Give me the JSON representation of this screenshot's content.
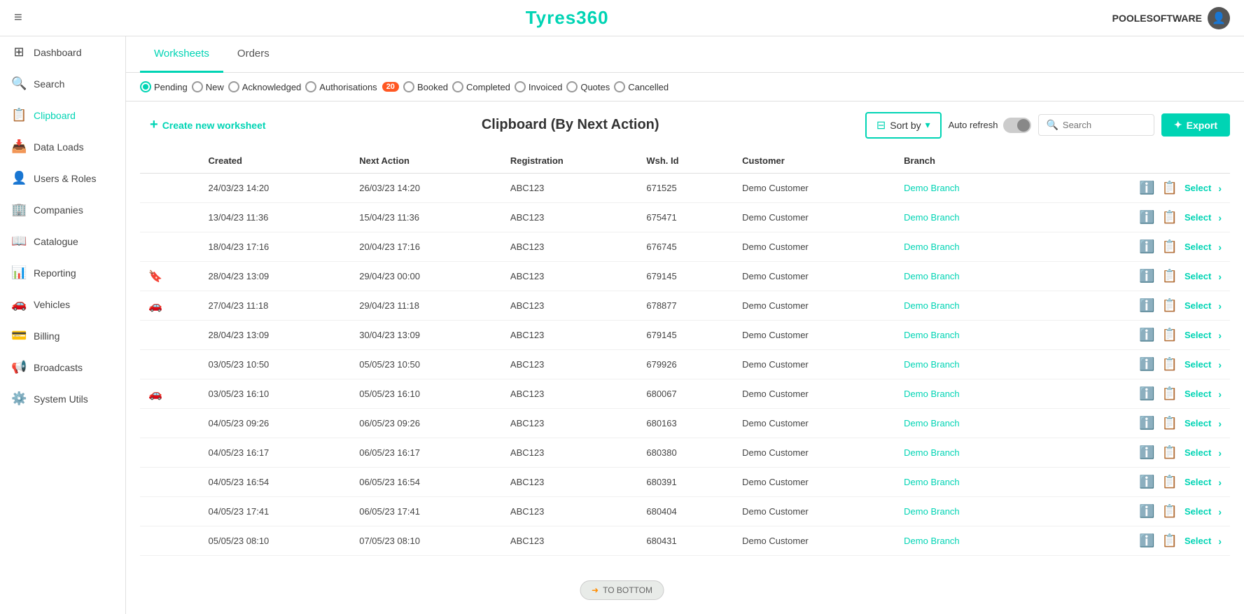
{
  "app": {
    "title": "Tyres360",
    "user": "POOLESOFTWARE"
  },
  "topbar": {
    "hamburger": "≡"
  },
  "sidebar": {
    "items": [
      {
        "id": "dashboard",
        "label": "Dashboard",
        "icon": "⊞",
        "active": false
      },
      {
        "id": "search",
        "label": "Search",
        "icon": "🔍",
        "active": false
      },
      {
        "id": "clipboard",
        "label": "Clipboard",
        "icon": "📋",
        "active": true
      },
      {
        "id": "data-loads",
        "label": "Data Loads",
        "icon": "📥",
        "active": false
      },
      {
        "id": "users-roles",
        "label": "Users & Roles",
        "icon": "👤",
        "active": false
      },
      {
        "id": "companies",
        "label": "Companies",
        "icon": "🏢",
        "active": false
      },
      {
        "id": "catalogue",
        "label": "Catalogue",
        "icon": "📖",
        "active": false
      },
      {
        "id": "reporting",
        "label": "Reporting",
        "icon": "📊",
        "active": false
      },
      {
        "id": "vehicles",
        "label": "Vehicles",
        "icon": "🚗",
        "active": false
      },
      {
        "id": "billing",
        "label": "Billing",
        "icon": "💳",
        "active": false
      },
      {
        "id": "broadcasts",
        "label": "Broadcasts",
        "icon": "📢",
        "active": false
      },
      {
        "id": "system-utils",
        "label": "System Utils",
        "icon": "⚙️",
        "active": false
      }
    ]
  },
  "tabs": [
    {
      "id": "worksheets",
      "label": "Worksheets",
      "active": true
    },
    {
      "id": "orders",
      "label": "Orders",
      "active": false
    }
  ],
  "filters": [
    {
      "id": "pending",
      "label": "Pending",
      "checked": true,
      "badge": null
    },
    {
      "id": "new",
      "label": "New",
      "checked": false,
      "badge": null
    },
    {
      "id": "acknowledged",
      "label": "Acknowledged",
      "checked": false,
      "badge": null
    },
    {
      "id": "authorisations",
      "label": "Authorisations",
      "checked": false,
      "badge": "20"
    },
    {
      "id": "booked",
      "label": "Booked",
      "checked": false,
      "badge": null
    },
    {
      "id": "completed",
      "label": "Completed",
      "checked": false,
      "badge": null
    },
    {
      "id": "invoiced",
      "label": "Invoiced",
      "checked": false,
      "badge": null
    },
    {
      "id": "quotes",
      "label": "Quotes",
      "checked": false,
      "badge": null
    },
    {
      "id": "cancelled",
      "label": "Cancelled",
      "checked": false,
      "badge": null
    }
  ],
  "toolbar": {
    "create_label": "Create new worksheet",
    "title": "Clipboard (By Next Action)",
    "sort_label": "Sort by",
    "auto_refresh_label": "Auto refresh",
    "search_placeholder": "Search",
    "export_label": "Export"
  },
  "table": {
    "columns": [
      "",
      "Created",
      "Next Action",
      "Registration",
      "Wsh. Id",
      "Customer",
      "Branch",
      ""
    ],
    "rows": [
      {
        "icon": "",
        "created": "24/03/23 14:20",
        "next_action": "26/03/23 14:20",
        "registration": "ABC123",
        "wsh_id": "671525",
        "customer": "Demo Customer",
        "branch": "Demo Branch"
      },
      {
        "icon": "",
        "created": "13/04/23 11:36",
        "next_action": "15/04/23 11:36",
        "registration": "ABC123",
        "wsh_id": "675471",
        "customer": "Demo Customer",
        "branch": "Demo Branch"
      },
      {
        "icon": "",
        "created": "18/04/23 17:16",
        "next_action": "20/04/23 17:16",
        "registration": "ABC123",
        "wsh_id": "676745",
        "customer": "Demo Customer",
        "branch": "Demo Branch"
      },
      {
        "icon": "bookmark",
        "created": "28/04/23 13:09",
        "next_action": "29/04/23 00:00",
        "registration": "ABC123",
        "wsh_id": "679145",
        "customer": "Demo Customer",
        "branch": "Demo Branch"
      },
      {
        "icon": "vehicle",
        "created": "27/04/23 11:18",
        "next_action": "29/04/23 11:18",
        "registration": "ABC123",
        "wsh_id": "678877",
        "customer": "Demo Customer",
        "branch": "Demo Branch"
      },
      {
        "icon": "",
        "created": "28/04/23 13:09",
        "next_action": "30/04/23 13:09",
        "registration": "ABC123",
        "wsh_id": "679145",
        "customer": "Demo Customer",
        "branch": "Demo Branch"
      },
      {
        "icon": "",
        "created": "03/05/23 10:50",
        "next_action": "05/05/23 10:50",
        "registration": "ABC123",
        "wsh_id": "679926",
        "customer": "Demo Customer",
        "branch": "Demo Branch"
      },
      {
        "icon": "vehicle",
        "created": "03/05/23 16:10",
        "next_action": "05/05/23 16:10",
        "registration": "ABC123",
        "wsh_id": "680067",
        "customer": "Demo Customer",
        "branch": "Demo Branch"
      },
      {
        "icon": "",
        "created": "04/05/23 09:26",
        "next_action": "06/05/23 09:26",
        "registration": "ABC123",
        "wsh_id": "680163",
        "customer": "Demo Customer",
        "branch": "Demo Branch"
      },
      {
        "icon": "",
        "created": "04/05/23 16:17",
        "next_action": "06/05/23 16:17",
        "registration": "ABC123",
        "wsh_id": "680380",
        "customer": "Demo Customer",
        "branch": "Demo Branch"
      },
      {
        "icon": "",
        "created": "04/05/23 16:54",
        "next_action": "06/05/23 16:54",
        "registration": "ABC123",
        "wsh_id": "680391",
        "customer": "Demo Customer",
        "branch": "Demo Branch"
      },
      {
        "icon": "",
        "created": "04/05/23 17:41",
        "next_action": "06/05/23 17:41",
        "registration": "ABC123",
        "wsh_id": "680404",
        "customer": "Demo Customer",
        "branch": "Demo Branch"
      },
      {
        "icon": "",
        "created": "05/05/23 08:10",
        "next_action": "07/05/23 08:10",
        "registration": "ABC123",
        "wsh_id": "680431",
        "customer": "Demo Customer",
        "branch": "Demo Branch"
      }
    ],
    "select_label": "Select",
    "row_actions": {
      "info": "ℹ",
      "list": "≡",
      "select": "Select",
      "chevron": "›"
    }
  },
  "bottom_bar": {
    "label": "TO BOTTOM",
    "arrow": "➜"
  },
  "colors": {
    "accent": "#00d4b4",
    "badge": "#ff5722"
  }
}
